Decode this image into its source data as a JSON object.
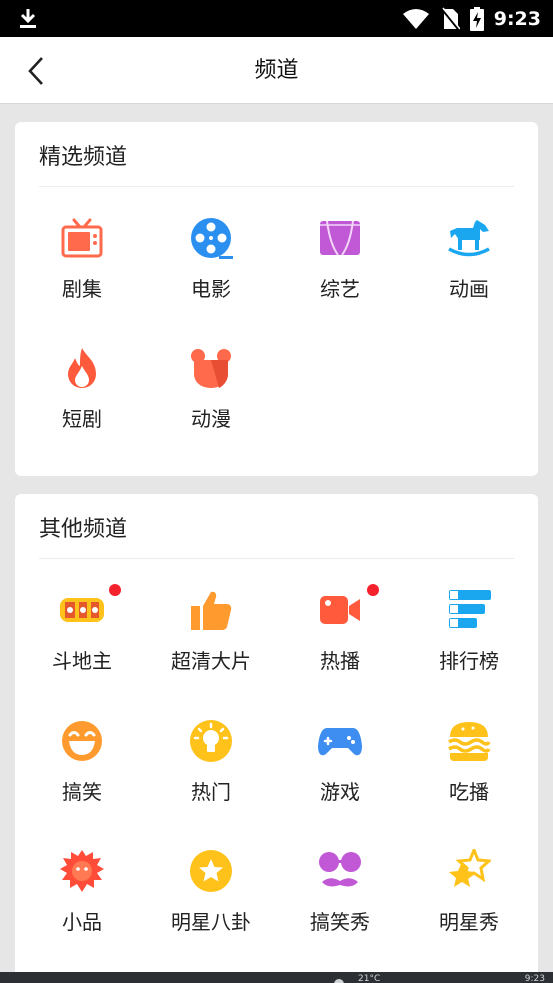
{
  "status_bar": {
    "time": "9:23"
  },
  "header": {
    "title": "频道"
  },
  "featured": {
    "title": "精选频道",
    "items": [
      {
        "label": "剧集",
        "icon": "tv-icon"
      },
      {
        "label": "电影",
        "icon": "film-reel-icon"
      },
      {
        "label": "综艺",
        "icon": "stage-curtain-icon"
      },
      {
        "label": "动画",
        "icon": "rocking-horse-icon"
      },
      {
        "label": "短剧",
        "icon": "flame-icon"
      },
      {
        "label": "动漫",
        "icon": "bear-icon"
      }
    ]
  },
  "other": {
    "title": "其他频道",
    "items": [
      {
        "label": "斗地主",
        "icon": "doudizhu-logo-icon",
        "badge": true
      },
      {
        "label": "超清大片",
        "icon": "thumbs-up-icon"
      },
      {
        "label": "热播",
        "icon": "video-camera-icon",
        "badge": true
      },
      {
        "label": "排行榜",
        "icon": "ranking-list-icon"
      },
      {
        "label": "搞笑",
        "icon": "laughing-face-icon"
      },
      {
        "label": "热门",
        "icon": "lightbulb-icon"
      },
      {
        "label": "游戏",
        "icon": "gamepad-icon"
      },
      {
        "label": "吃播",
        "icon": "burger-icon"
      },
      {
        "label": "小品",
        "icon": "lion-mask-icon"
      },
      {
        "label": "明星八卦",
        "icon": "star-badge-icon"
      },
      {
        "label": "搞笑秀",
        "icon": "glasses-mustache-icon"
      },
      {
        "label": "明星秀",
        "icon": "double-star-icon"
      }
    ]
  },
  "colors": {
    "tv": "#ff6a4d",
    "film": "#2b8ff0",
    "variety": "#c158d6",
    "animation": "#1aa7ef",
    "flame": "#ff5a3c",
    "bear": "#ff6a4d",
    "thumb": "#ff9a2e",
    "camera": "#ff5a3c",
    "rank": "#1aa7ef",
    "laugh": "#ff9a2e",
    "bulb": "#ffc21a",
    "gamepad": "#3d8ef0",
    "burger": "#ffc21a",
    "lion": "#ff4d3a",
    "star_badge": "#ffc21a",
    "glasses": "#c158d6",
    "double_star": "#ffc21a",
    "badge": "#f5222d"
  },
  "taskbar": {
    "temp": "21°C",
    "time": "9:23"
  }
}
